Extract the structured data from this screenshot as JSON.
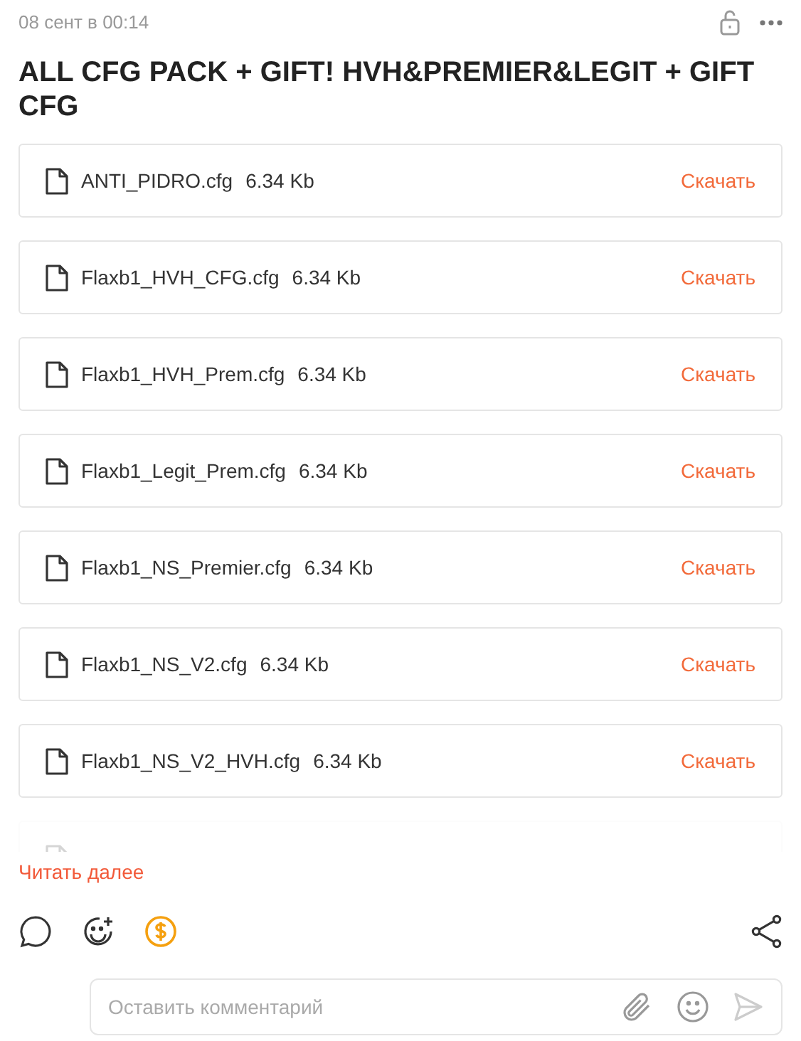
{
  "post": {
    "date": "08 сент в 00:14",
    "title": "ALL CFG PACK + GIFT! HVH&PREMIER&LEGIT + GIFT CFG"
  },
  "files": [
    {
      "name": "ANTI_PIDRO.cfg",
      "size": "6.34 Kb",
      "action": "Скачать"
    },
    {
      "name": "Flaxb1_HVH_CFG.cfg",
      "size": "6.34 Kb",
      "action": "Скачать"
    },
    {
      "name": "Flaxb1_HVH_Prem.cfg",
      "size": "6.34 Kb",
      "action": "Скачать"
    },
    {
      "name": "Flaxb1_Legit_Prem.cfg",
      "size": "6.34 Kb",
      "action": "Скачать"
    },
    {
      "name": "Flaxb1_NS_Premier.cfg",
      "size": "6.34 Kb",
      "action": "Скачать"
    },
    {
      "name": "Flaxb1_NS_V2.cfg",
      "size": "6.34 Kb",
      "action": "Скачать"
    },
    {
      "name": "Flaxb1_NS_V2_HVH.cfg",
      "size": "6.34 Kb",
      "action": "Скачать"
    }
  ],
  "read_more": "Читать далее",
  "comment": {
    "placeholder": "Оставить комментарий"
  }
}
